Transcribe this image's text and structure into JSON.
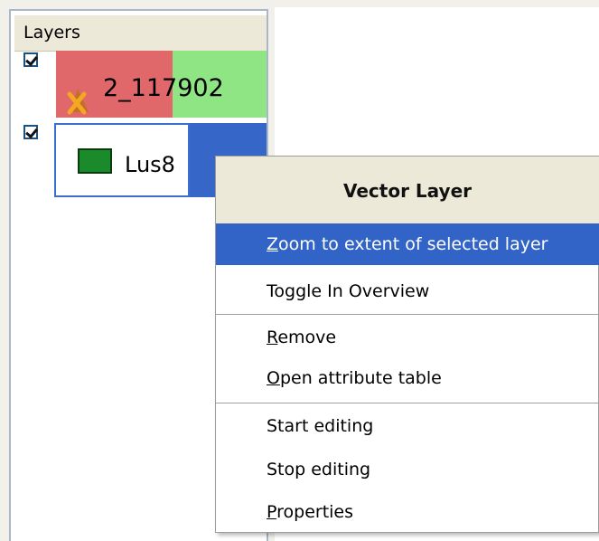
{
  "layers_panel": {
    "title": "Layers",
    "layers": [
      {
        "name": "2_117902",
        "checked": true,
        "status_icon": "warning-x-icon"
      },
      {
        "name": "Lus8",
        "checked": true,
        "swatch_color": "#1b8a2a",
        "selected": true
      }
    ]
  },
  "context_menu": {
    "title": "Vector Layer",
    "items": [
      {
        "label": "Zoom to extent of selected layer",
        "underline": "Z",
        "rest": "oom to extent of selected layer",
        "selected": true
      },
      {
        "label": "Toggle In Overview",
        "underline": "",
        "rest": "Toggle In Overview"
      },
      {
        "label": "Remove",
        "underline": "R",
        "rest": "emove"
      },
      {
        "label": "Open attribute table",
        "underline": "O",
        "rest": "pen attribute table"
      },
      {
        "label": "Start editing",
        "underline": "",
        "rest": "Start editing"
      },
      {
        "label": "Stop editing",
        "underline": "",
        "rest": "Stop editing"
      },
      {
        "label": "Properties",
        "underline": "P",
        "rest": "roperties"
      }
    ]
  },
  "colors": {
    "selection": "#3264c8",
    "layer1_left": "#e0676a",
    "layer1_right": "#8fe584",
    "menu_header": "#ece9d8"
  }
}
